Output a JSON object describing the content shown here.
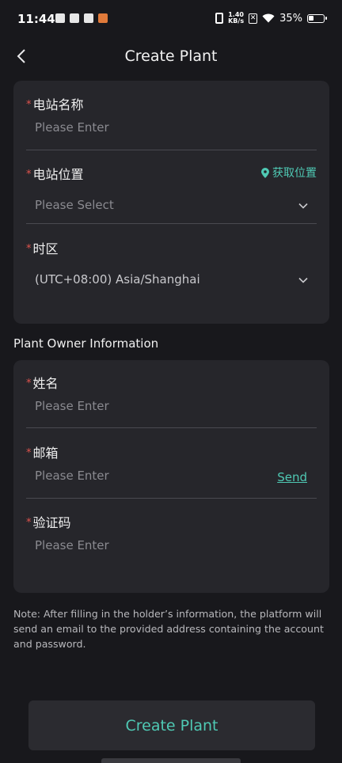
{
  "status_bar": {
    "time": "11:44",
    "net_speed_top": "1.40",
    "net_speed_bottom": "KB/s",
    "battery": "35%"
  },
  "nav": {
    "title": "Create Plant",
    "back_icon": "chevron-left-icon"
  },
  "plant": {
    "name_label": "电站名称",
    "name_placeholder": "Please Enter",
    "location_label": "电站位置",
    "location_action": "获取位置",
    "location_placeholder": "Please Select",
    "timezone_label": "时区",
    "timezone_value": "(UTC+08:00) Asia/Shanghai",
    "required_mark": "*"
  },
  "owner": {
    "section_title": "Plant Owner Information",
    "name_label": "姓名",
    "name_placeholder": "Please Enter",
    "email_label": "邮箱",
    "email_placeholder": "Please Enter",
    "send_label": "Send",
    "code_label": "验证码",
    "code_placeholder": "Please Enter"
  },
  "note": "Note: After filling in the holder’s information, the platform will send an email to the provided address containing the account and password.",
  "submit_label": "Create Plant",
  "colors": {
    "accent": "#4fc9b4",
    "required": "#e0534d",
    "background": "#18181c",
    "card": "#26262b"
  }
}
